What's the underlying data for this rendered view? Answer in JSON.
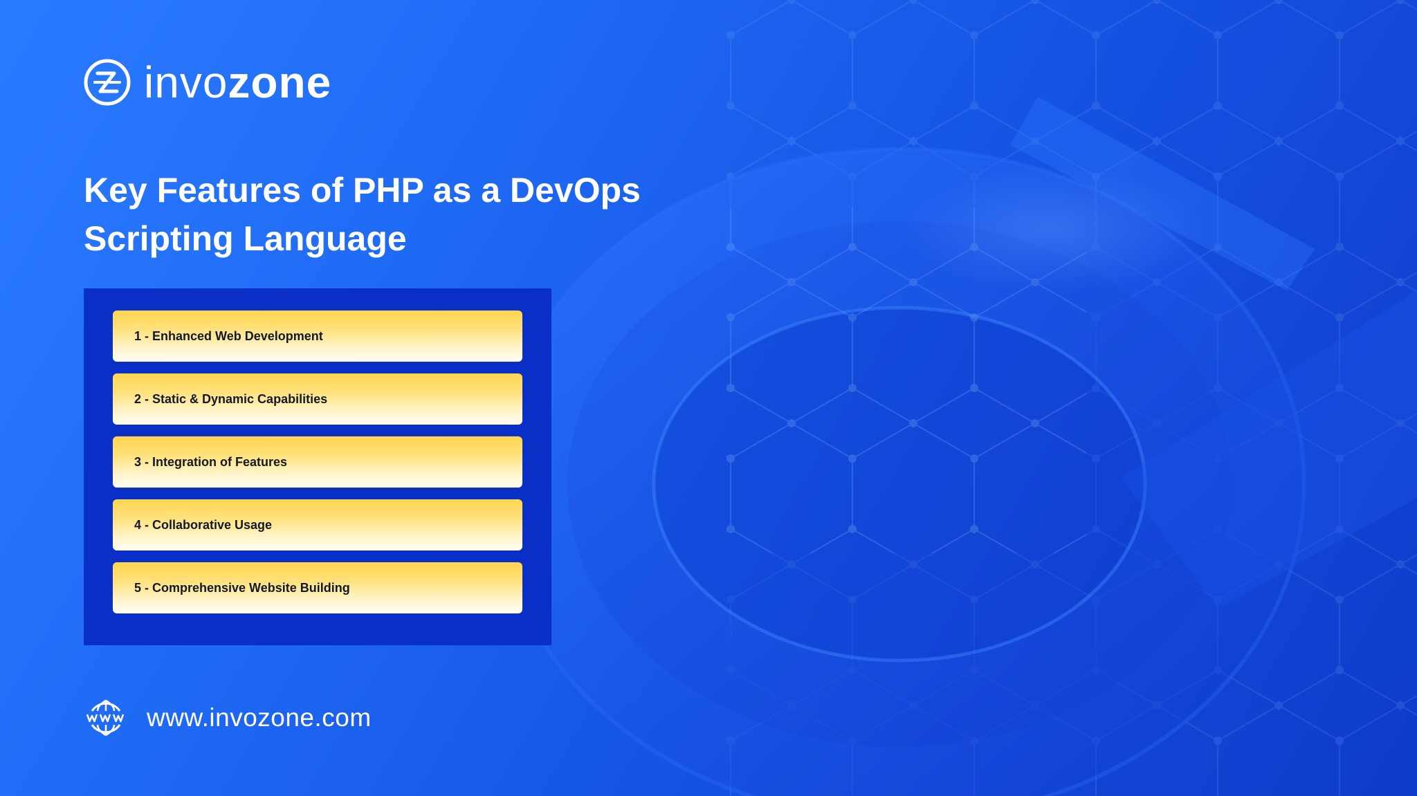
{
  "brand": {
    "name_light": "invo",
    "name_bold": "zone",
    "logo_icon": "invozone-logo-icon"
  },
  "slide": {
    "title_line1": "Key Features of PHP as a DevOps",
    "title_line2": "Scripting Language"
  },
  "features": [
    {
      "label": "1 - Enhanced Web Development"
    },
    {
      "label": "2 - Static & Dynamic Capabilities"
    },
    {
      "label": "3 - Integration of Features"
    },
    {
      "label": "4 - Collaborative Usage"
    },
    {
      "label": "5 - Comprehensive Website Building"
    }
  ],
  "footer": {
    "url": "www.invozone.com",
    "icon": "globe-www-icon"
  },
  "colors": {
    "background": "#1f6af5",
    "panel": "#0a2fc6",
    "item_top": "#ffd54f",
    "item_bottom": "#fffdf4",
    "text_light": "#ffffff",
    "text_dark": "#141824"
  }
}
